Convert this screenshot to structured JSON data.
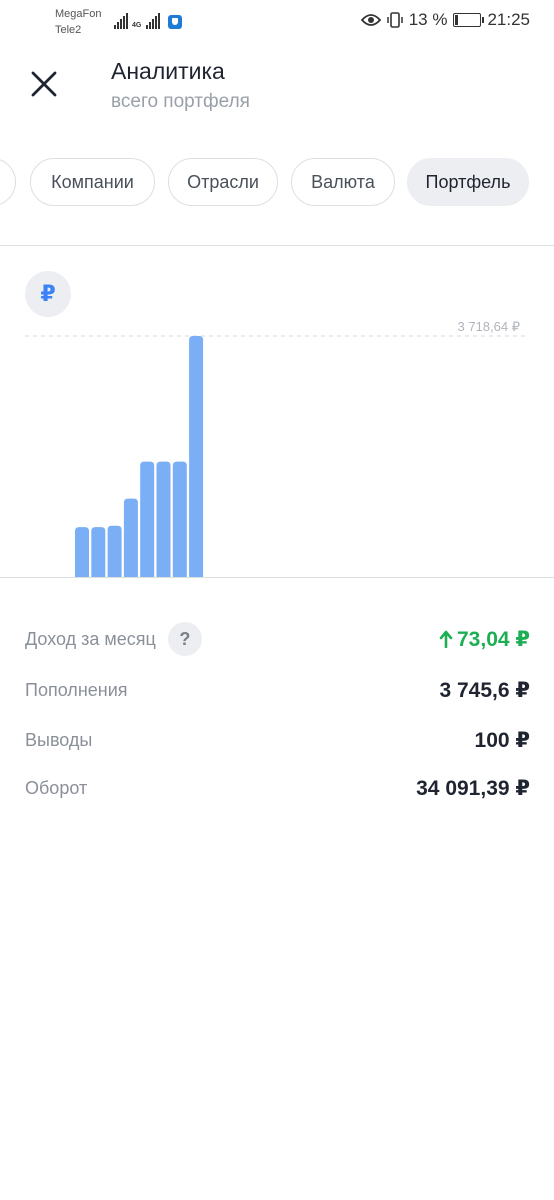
{
  "status_bar": {
    "carrier1": "MegaFon",
    "carrier2": "Tele2",
    "network": "4G",
    "battery": "13 %",
    "battery_level": 0.13,
    "time": "21:25"
  },
  "header": {
    "title": "Аналитика",
    "subtitle": "всего портфеля",
    "close_icon": "close-icon"
  },
  "tabs": [
    {
      "label": "Компании",
      "active": false
    },
    {
      "label": "Отрасли",
      "active": false
    },
    {
      "label": "Валюта",
      "active": false
    },
    {
      "label": "Портфель",
      "active": true
    }
  ],
  "chart": {
    "currency_symbol": "₽",
    "max_label": "3 718,64 ₽"
  },
  "chart_data": {
    "type": "bar",
    "title": "",
    "categories": [
      "",
      "",
      "",
      "",
      "",
      "",
      "",
      ""
    ],
    "values": [
      770,
      770,
      790,
      1210,
      1780,
      1780,
      1780,
      3718.64
    ],
    "ylim": [
      0,
      3718.64
    ],
    "bar_color": "#7aaef5",
    "grid": false
  },
  "stats": {
    "income_label": "Доход за месяц",
    "income_value": "73,04 ₽",
    "income_color": "#1eaf55",
    "help_label": "?",
    "deposits_label": "Пополнения",
    "deposits_value": "3 745,6 ₽",
    "withdrawals_label": "Выводы",
    "withdrawals_value": "100 ₽",
    "turnover_label": "Оборот",
    "turnover_value": "34 091,39 ₽"
  }
}
